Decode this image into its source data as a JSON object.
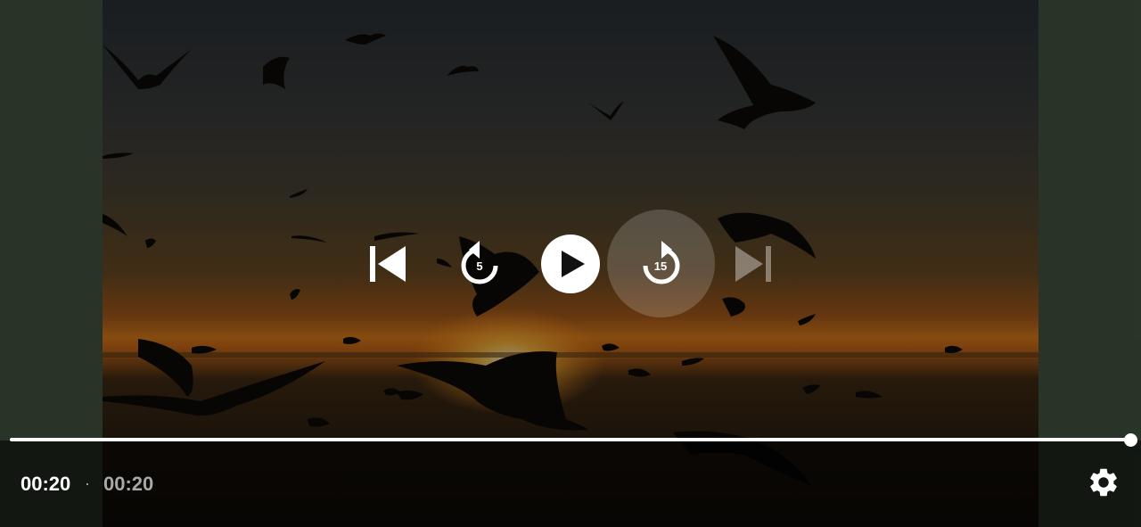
{
  "player": {
    "current_time": "00:20",
    "separator": "·",
    "duration": "00:20",
    "progress": 1.0,
    "state": "paused"
  },
  "controls": {
    "skip_previous": "skip-previous-icon",
    "rewind": "rewind-icon",
    "rewind_seconds": "5",
    "play": "play-icon",
    "forward": "forward-icon",
    "forward_seconds": "15",
    "skip_next": "skip-next-icon",
    "skip_next_enabled": false,
    "settings": "gear-icon"
  },
  "colors": {
    "pillarbox": "#425540",
    "control_white": "#ffffff",
    "duration_text": "#a8a8a8"
  }
}
